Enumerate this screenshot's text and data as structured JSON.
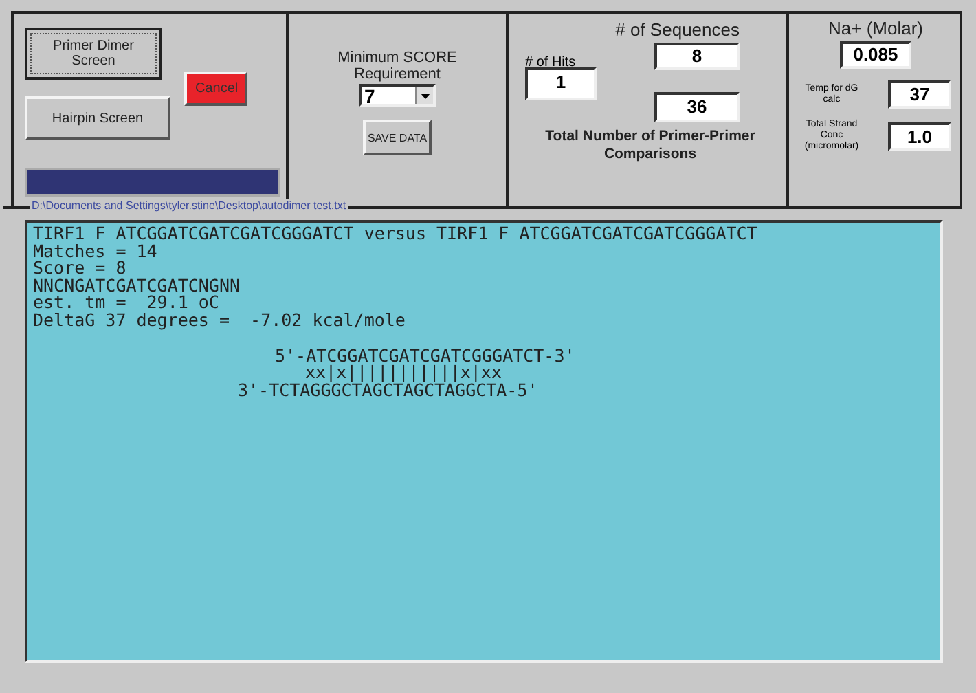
{
  "screen_panel": {
    "buttons": [
      {
        "label": "Primer Dimer Screen",
        "kind": "focused"
      },
      {
        "label": "Hairpin Screen",
        "kind": "plain"
      },
      {
        "label": "Cancel",
        "kind": "danger"
      }
    ]
  },
  "score_panel": {
    "label": "Minimum SCORE Requirement",
    "score": "7",
    "save_button": "SAVE DATA"
  },
  "sequences_panel": {
    "title": "# of Sequences",
    "hits_label": "# of Hits",
    "hits": "1",
    "sequences": "8",
    "comparisons": "36",
    "comparisons_label": "Total Number of Primer-Primer Comparisons"
  },
  "conditions_panel": {
    "na_label": "Na+ (Molar)",
    "na": "0.085",
    "temp_label": "Temp for dG calc",
    "temp": "37",
    "conc_label": "Total Strand Conc (micromolar)",
    "conc": "1.0"
  },
  "file_path": "D:\\Documents and Settings\\tyler.stine\\Desktop\\autodimer test.txt",
  "output": {
    "lines": [
      "TIRF1 F ATCGGATCGATCGATCGGGATCT versus TIRF1 F ATCGGATCGATCGATCGGGATCT",
      "Matches = 14",
      "Score = 8",
      "NNCNGATCGATCGATCNGNN",
      "est. tm =  29.1 oC",
      "DeltaG 37 degrees =  -7.02 kcal/mole"
    ],
    "alignment": [
      "5'-ATCGGATCGATCGATCGGGATCT-3'",
      "xx|x|||||||||||x|xx",
      "3'-TCTAGGGCTAGCTAGCTAGGCTA-5'"
    ]
  }
}
